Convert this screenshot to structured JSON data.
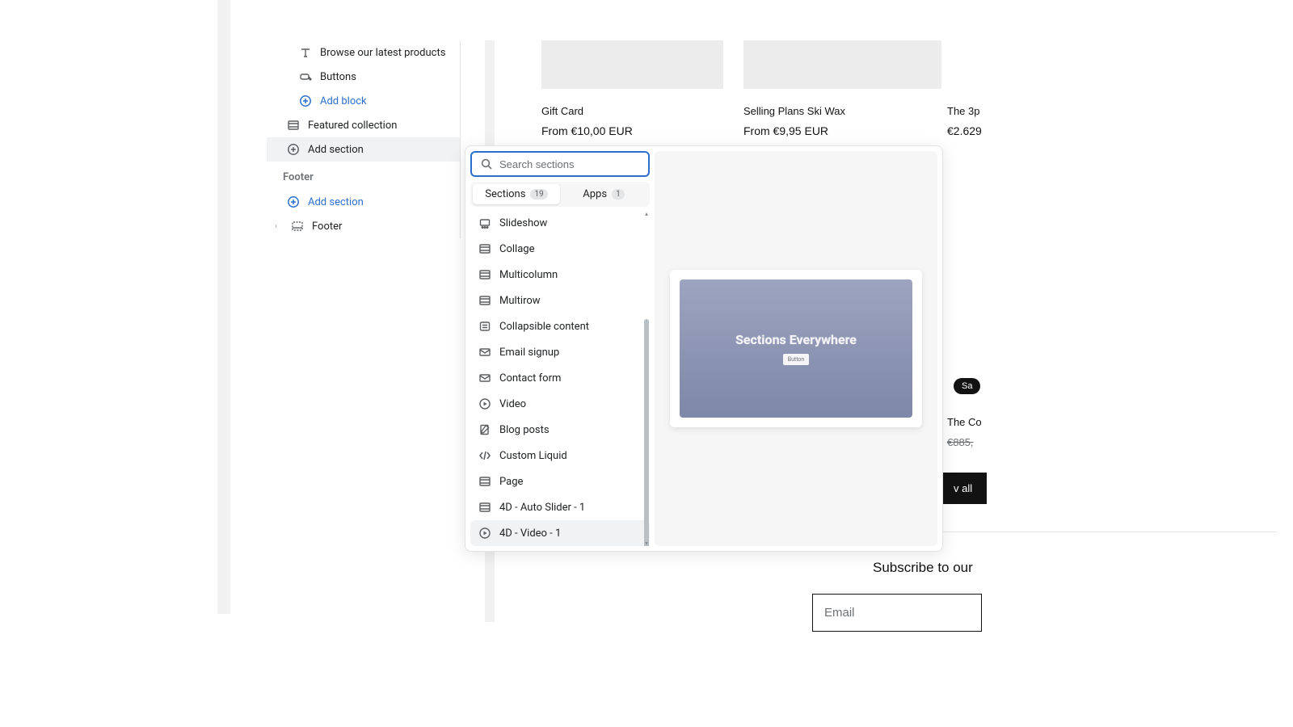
{
  "sidebar": {
    "items": [
      {
        "label": "Browse our latest products",
        "icon": "text"
      },
      {
        "label": "Buttons",
        "icon": "buttons"
      }
    ],
    "add_block": "Add block",
    "featured": "Featured collection",
    "add_section": "Add section",
    "footer_header": "Footer",
    "footer_add_section": "Add section",
    "footer_item": "Footer"
  },
  "picker": {
    "search_placeholder": "Search sections",
    "tab_sections": "Sections",
    "tab_sections_count": "19",
    "tab_apps": "Apps",
    "tab_apps_count": "1",
    "sections": [
      {
        "label": "Slideshow",
        "icon": "slideshow"
      },
      {
        "label": "Collage",
        "icon": "section"
      },
      {
        "label": "Multicolumn",
        "icon": "section"
      },
      {
        "label": "Multirow",
        "icon": "section"
      },
      {
        "label": "Collapsible content",
        "icon": "collapsible"
      },
      {
        "label": "Email signup",
        "icon": "mail"
      },
      {
        "label": "Contact form",
        "icon": "mail"
      },
      {
        "label": "Video",
        "icon": "play"
      },
      {
        "label": "Blog posts",
        "icon": "blog"
      },
      {
        "label": "Custom Liquid",
        "icon": "code"
      },
      {
        "label": "Page",
        "icon": "section"
      },
      {
        "label": "4D - Auto Slider - 1",
        "icon": "section"
      },
      {
        "label": "4D - Video - 1",
        "icon": "play"
      }
    ],
    "preview_title": "Sections Everywhere",
    "preview_btn": "Button"
  },
  "store": {
    "p1_name": "Gift Card",
    "p1_price": "From €10,00 EUR",
    "p2_name": "Selling Plans Ski Wax",
    "p2_price": "From €9,95 EUR",
    "p3_name": "The 3p",
    "p3_price": "€2.629",
    "sale_badge": "Sa",
    "p4_name": "The Co",
    "p4_oldprice": "€885,",
    "viewall": "v all",
    "subscribe": "Subscribe to our",
    "email_placeholder": "Email"
  }
}
